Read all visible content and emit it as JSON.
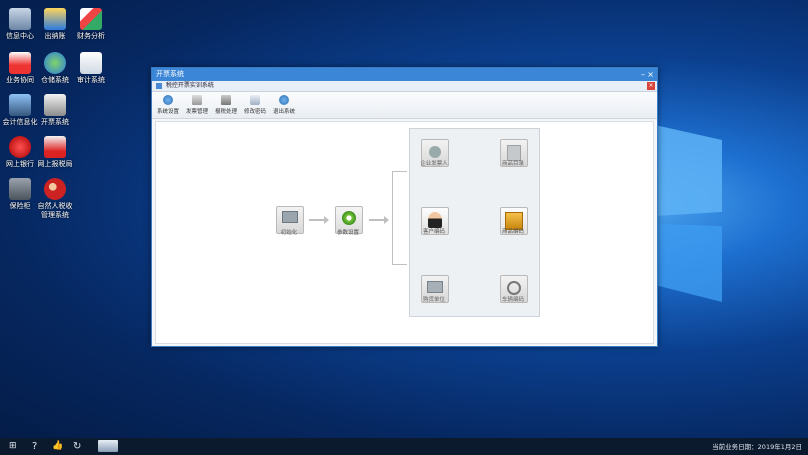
{
  "desktop": {
    "icons": [
      {
        "label": "信息中心",
        "icon": "info-center-icon"
      },
      {
        "label": "出纳账",
        "icon": "cashier-ledger-icon"
      },
      {
        "label": "财务分析",
        "icon": "finance-analysis-icon"
      },
      {
        "label": "业务协同",
        "icon": "business-collab-icon"
      },
      {
        "label": "仓储系统",
        "icon": "warehouse-icon"
      },
      {
        "label": "审计系统",
        "icon": "audit-icon"
      },
      {
        "label": "会计信息化",
        "icon": "accounting-icon"
      },
      {
        "label": "开票系统",
        "icon": "invoice-system-icon"
      },
      {
        "label": "网上银行",
        "icon": "online-bank-icon"
      },
      {
        "label": "网上报税局",
        "icon": "tax-bureau-icon"
      },
      {
        "label": "保险柜",
        "icon": "safe-icon"
      },
      {
        "label": "自然人税收",
        "icon": "personal-tax-icon",
        "label2": "管理系统"
      }
    ]
  },
  "window": {
    "title": "开票系统",
    "subtitle": "税控开票实训系统",
    "toolbar": [
      {
        "label": "系统设置",
        "icon": "settings-icon"
      },
      {
        "label": "发票管理",
        "icon": "invoice-manage-icon"
      },
      {
        "label": "报税处理",
        "icon": "tax-report-icon"
      },
      {
        "label": "修改密码",
        "icon": "lock-icon"
      },
      {
        "label": "退出系统",
        "icon": "exit-icon"
      }
    ],
    "flow": {
      "init": "初始化",
      "params": "参数设置",
      "items": [
        "企业发票人",
        "商品目录",
        "客户编码",
        "商品编码",
        "购货单位",
        "车辆编码"
      ]
    }
  },
  "taskbar": {
    "date_text": "当前业务日期：2019年1月2日"
  }
}
